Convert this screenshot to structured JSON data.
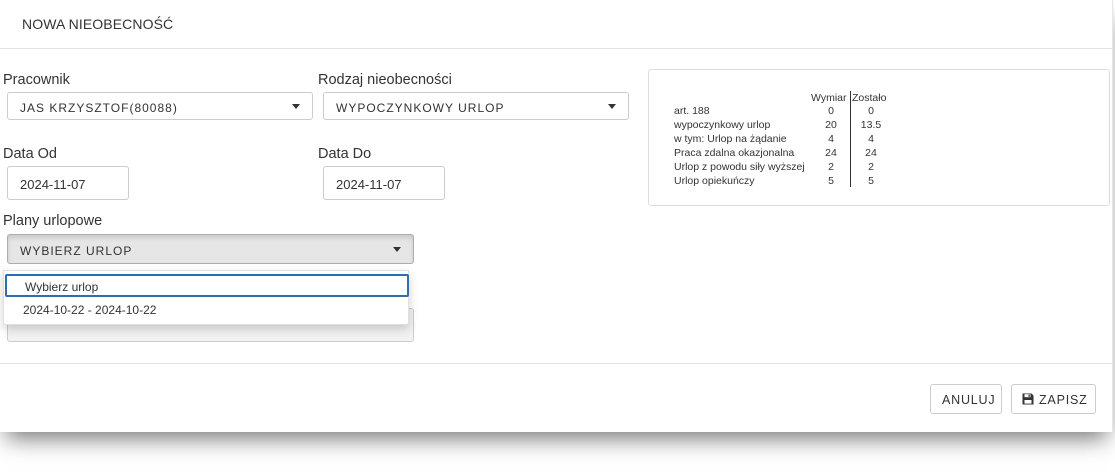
{
  "modal": {
    "title": "NOWA NIEOBECNOŚĆ"
  },
  "form": {
    "employee_label": "Pracownik",
    "employee_value": "JAS KRZYSZTOF(80088)",
    "absence_type_label": "Rodzaj nieobecności",
    "absence_type_value": "WYPOCZYNKOWY URLOP",
    "date_from_label": "Data Od",
    "date_from_value": "2024-11-07",
    "date_to_label": "Data Do",
    "date_to_value": "2024-11-07",
    "leave_plans_label": "Plany urlopowe",
    "leave_plans_value": "WYBIERZ URLOP",
    "leave_plans_options": [
      "Wybierz urlop",
      "2024-10-22 - 2024-10-22"
    ]
  },
  "balance": {
    "columns": [
      "Wymiar",
      "Zostało"
    ],
    "rows": [
      {
        "name": "art. 188",
        "wymiar": "0",
        "zostalo": "0"
      },
      {
        "name": "wypoczynkowy urlop",
        "wymiar": "20",
        "zostalo": "13.5"
      },
      {
        "name": "w tym: Urlop na żądanie",
        "wymiar": "4",
        "zostalo": "4"
      },
      {
        "name": "Praca zdalna okazjonalna",
        "wymiar": "24",
        "zostalo": "24"
      },
      {
        "name": "Urlop z powodu siły wyższej",
        "wymiar": "2",
        "zostalo": "2"
      },
      {
        "name": "Urlop opiekuńczy",
        "wymiar": "5",
        "zostalo": "5"
      }
    ]
  },
  "footer": {
    "cancel_label": "ANULUJ",
    "save_label": "ZAPISZ"
  }
}
